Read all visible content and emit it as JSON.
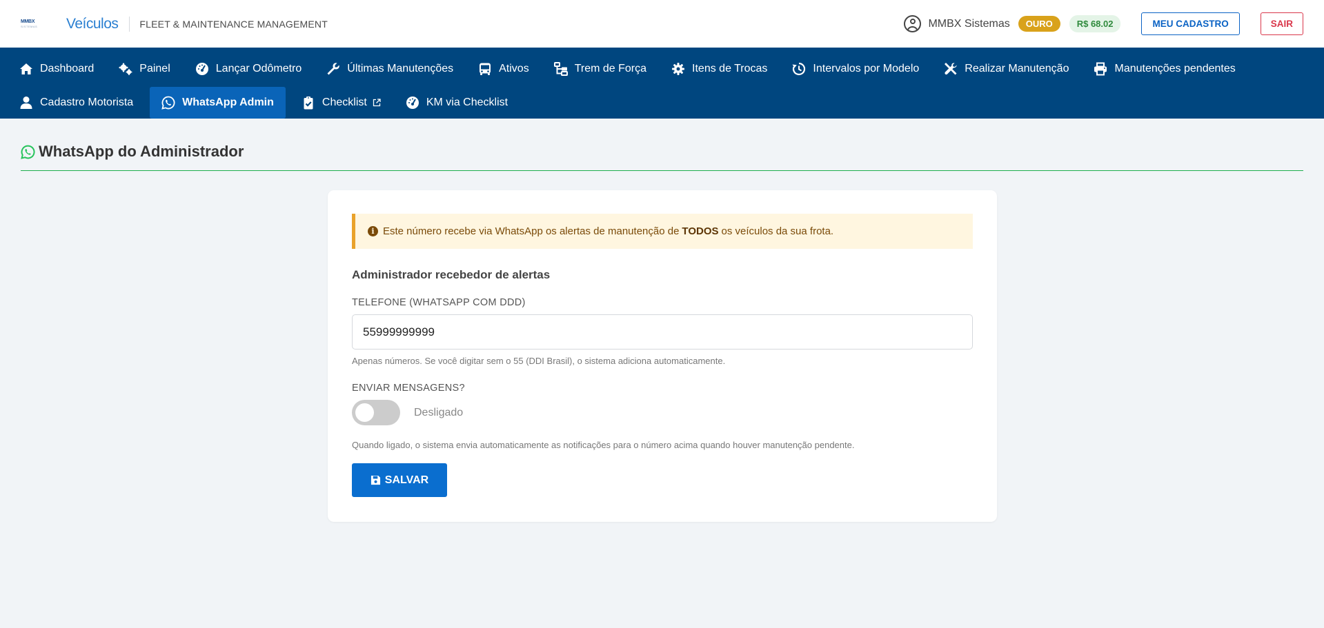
{
  "header": {
    "logo_text": "MMBX",
    "logo_subtext": "SISTEMAS",
    "app_name": "Veículos",
    "subtitle": "FLEET & MAINTENANCE MANAGEMENT",
    "user_name": "MMBX Sistemas",
    "plan_badge": "OURO",
    "balance": "R$ 68.02",
    "profile_button": "MEU CADASTRO",
    "logout_button": "SAIR"
  },
  "nav": {
    "row1": [
      {
        "label": "Dashboard",
        "icon": "home-icon"
      },
      {
        "label": "Painel",
        "icon": "gears-icon"
      },
      {
        "label": "Lançar Odômetro",
        "icon": "tachometer-icon"
      },
      {
        "label": "Últimas Manutenções",
        "icon": "wrench-icon"
      },
      {
        "label": "Ativos",
        "icon": "bus-icon"
      },
      {
        "label": "Trem de Força",
        "icon": "sitemap-icon"
      },
      {
        "label": "Itens de Trocas",
        "icon": "cog-icon"
      },
      {
        "label": "Intervalos por Modelo",
        "icon": "history-icon"
      },
      {
        "label": "Realizar Manutenção",
        "icon": "tools-icon"
      },
      {
        "label": "Manutenções pendentes",
        "icon": "print-icon"
      }
    ],
    "row2": [
      {
        "label": "Cadastro Motorista",
        "icon": "user-icon"
      },
      {
        "label": "WhatsApp Admin",
        "icon": "whatsapp-icon",
        "active": true
      },
      {
        "label": "Checklist",
        "icon": "clipboard-check-icon",
        "external": true
      },
      {
        "label": "KM via Checklist",
        "icon": "tachometer-icon"
      }
    ]
  },
  "page": {
    "title": "WhatsApp do Administrador"
  },
  "form": {
    "alert_prefix": "Este número recebe via WhatsApp os alertas de manutenção de",
    "alert_bold": "TODOS",
    "alert_suffix": "os veículos da sua frota.",
    "section_title": "Administrador recebedor de alertas",
    "phone_label": "TELEFONE (WHATSAPP COM DDD)",
    "phone_value": "55999999999",
    "phone_help": "Apenas números. Se você digitar sem o 55 (DDI Brasil), o sistema adiciona automaticamente.",
    "send_label": "ENVIAR MENSAGENS?",
    "toggle_state": "Desligado",
    "send_help": "Quando ligado, o sistema envia automaticamente as notificações para o número acima quando houver manutenção pendente.",
    "save_button": "SALVAR"
  },
  "colors": {
    "nav_bg": "#00467f",
    "active_tab": "#0a64b8",
    "accent_green": "#1cae4c",
    "plan_gold": "#d9a21b",
    "primary": "#0a6ecf",
    "danger": "#d9364a"
  }
}
